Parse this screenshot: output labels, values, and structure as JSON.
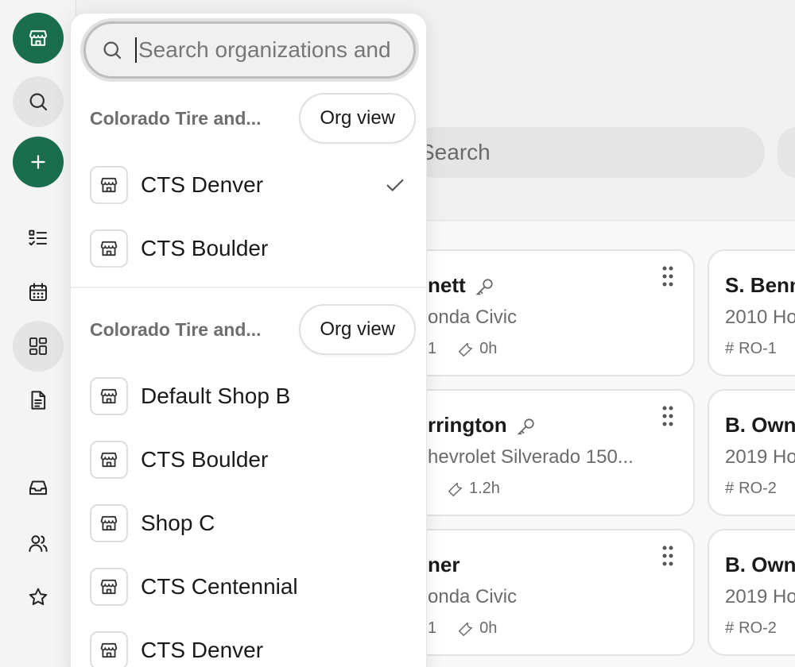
{
  "search": {
    "placeholder": "Search organizations and shops"
  },
  "main": {
    "search_placeholder": "Search"
  },
  "cards": [
    {
      "name": "nett",
      "vehicle": "onda Civic",
      "count": "1",
      "hours": "0h",
      "has_key": true
    },
    {
      "name": "S. Benn",
      "vehicle": "2010 Ho",
      "ro": "RO-1"
    },
    {
      "name": "rrington",
      "vehicle": "hevrolet Silverado 150...",
      "hours": "1.2h",
      "has_key": true
    },
    {
      "name": "B. Own",
      "vehicle": "2019 Ho",
      "ro": "RO-2"
    },
    {
      "name": "ner",
      "vehicle": "onda Civic",
      "count": "1",
      "hours": "0h"
    },
    {
      "name": "B. Own",
      "vehicle": "2019 Ho",
      "ro": "RO-2"
    }
  ],
  "orgs": [
    {
      "name": "Colorado Tire and...",
      "button": "Org view",
      "shops": [
        {
          "label": "CTS Denver",
          "selected": true
        },
        {
          "label": "CTS Boulder"
        }
      ]
    },
    {
      "name": "Colorado Tire and...",
      "button": "Org view",
      "shops": [
        {
          "label": "Default Shop B"
        },
        {
          "label": "CTS Boulder"
        },
        {
          "label": "Shop C"
        },
        {
          "label": "CTS Centennial"
        },
        {
          "label": "CTS Denver"
        }
      ]
    }
  ],
  "colors": {
    "accent": "#1a6e4e"
  }
}
